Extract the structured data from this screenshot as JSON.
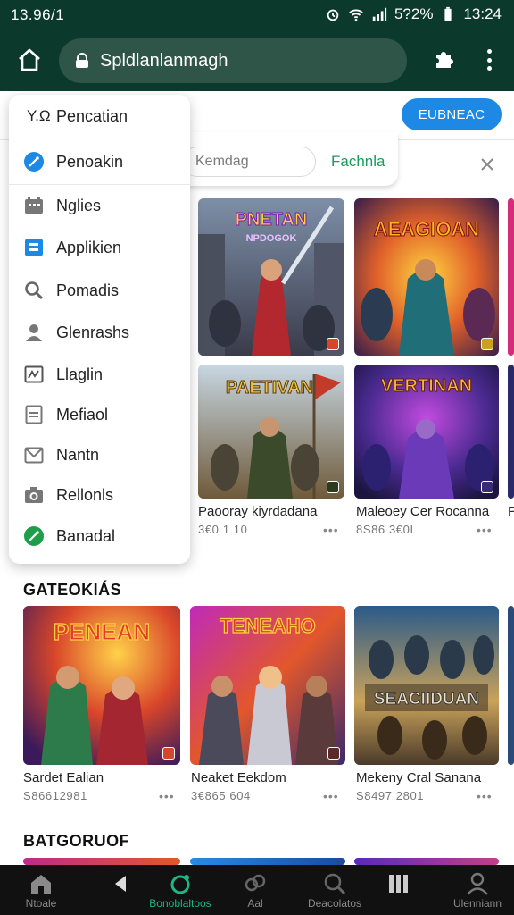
{
  "status_bar": {
    "time_left": "13.96/1",
    "battery": "5?2%",
    "time_right": "13:24"
  },
  "app_bar": {
    "url": "Spldlanlanmagh"
  },
  "content": {
    "primary_button": "EUBNEAC",
    "search_placeholder": "Kemdag",
    "search_action": "Fachnla",
    "row1": [
      {
        "title": "Paooray kiyrdadana",
        "sub": "3€0 1 10"
      },
      {
        "title": "Maleoey Cer Rocanna",
        "sub": "8S86 3€0I"
      }
    ],
    "section1_title": "GATEOKIÁS",
    "row2": [
      {
        "title": "Sardet Ealian",
        "sub": "S86612981"
      },
      {
        "title": "Neaket Eekdom",
        "sub": "3€865 604"
      },
      {
        "title": "Mekeny Cral Sanana",
        "sub": "S8497 2801"
      }
    ],
    "section2_title": "BATGORUOF",
    "art_texts": [
      "PNETAN",
      "NPDOGOK",
      "AEAGIOAN",
      "PAETIVAN",
      "VERTINAN",
      "PENEAN",
      "TENEAHO",
      "SEACIIDUAN"
    ]
  },
  "menu": {
    "header_code": "Y.Ω",
    "items": [
      {
        "label": "Pencatian",
        "icon": "text-icon"
      },
      {
        "label": "Penoakin",
        "icon": "pen-circle-icon",
        "color": "#1e88e5"
      },
      {
        "label": "Nglies",
        "icon": "grid-icon"
      },
      {
        "label": "Applikien",
        "icon": "app-square-icon",
        "color": "#1e88e5"
      },
      {
        "label": "Pomadis",
        "icon": "search-icon"
      },
      {
        "label": "Glenrashs",
        "icon": "person-icon"
      },
      {
        "label": "Llaglin",
        "icon": "chart-box-icon"
      },
      {
        "label": "Mefiaol",
        "icon": "document-icon"
      },
      {
        "label": "Nantn",
        "icon": "mail-icon"
      },
      {
        "label": "Rellonls",
        "icon": "camera-icon"
      },
      {
        "label": "Banadal",
        "icon": "check-circle-icon",
        "color": "#1e9e4a"
      }
    ]
  },
  "bottom_nav": [
    {
      "label": "Ntoale"
    },
    {
      "label": ""
    },
    {
      "label": "Bonoblaltoos"
    },
    {
      "label": "Aal"
    },
    {
      "label": "Deacolatos"
    },
    {
      "label": ""
    },
    {
      "label": "Ulenniann"
    }
  ],
  "colors": {
    "app_bar": "#0b3a2d",
    "accent_blue": "#1e88e5",
    "accent_green": "#1fb584"
  }
}
